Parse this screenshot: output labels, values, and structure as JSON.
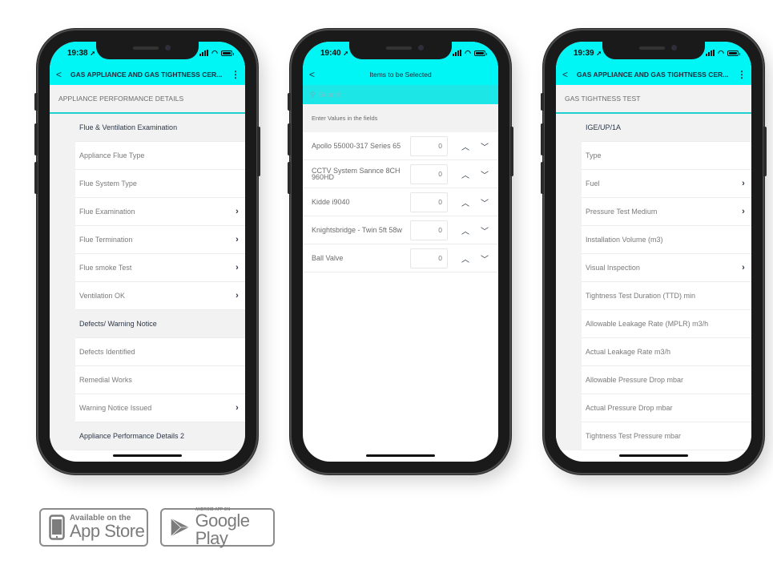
{
  "phones": [
    {
      "time": "19:38",
      "app_bar": {
        "back": "<",
        "title": "GAS APPLIANCE AND GAS TIGHTNESS CER...",
        "menu": "⋮"
      },
      "section_title": "APPLIANCE PERFORMANCE DETAILS",
      "rows": [
        {
          "label": "Flue & Ventilation Examination",
          "group": true,
          "chevron": false
        },
        {
          "label": "Appliance Flue Type",
          "group": false,
          "chevron": false
        },
        {
          "label": "Flue System Type",
          "group": false,
          "chevron": false
        },
        {
          "label": "Flue Examination",
          "group": false,
          "chevron": true
        },
        {
          "label": "Flue Termination",
          "group": false,
          "chevron": true
        },
        {
          "label": "Flue smoke Test",
          "group": false,
          "chevron": true
        },
        {
          "label": "Ventilation OK",
          "group": false,
          "chevron": true
        },
        {
          "label": "Defects/ Warning Notice",
          "group": true,
          "chevron": false
        },
        {
          "label": "Defects Identified",
          "group": false,
          "chevron": false
        },
        {
          "label": "Remedial Works",
          "group": false,
          "chevron": false
        },
        {
          "label": "Warning Notice Issued",
          "group": false,
          "chevron": true
        },
        {
          "label": "Appliance Performance Details 2",
          "group": true,
          "chevron": false
        }
      ]
    },
    {
      "time": "19:40",
      "app_bar": {
        "back": "<",
        "title": "Items to be Selected"
      },
      "search_placeholder": "Search",
      "hint": "Enter Values in the fields",
      "items": [
        {
          "name": "Apollo 55000-317 Series 65",
          "qty": "0"
        },
        {
          "name": "CCTV System Sannce 8CH 960HD",
          "qty": "0"
        },
        {
          "name": "Kidde i9040",
          "qty": "0"
        },
        {
          "name": "Knightsbridge - Twin 5ft 58w",
          "qty": "0"
        },
        {
          "name": "Ball Valve",
          "qty": "0"
        }
      ]
    },
    {
      "time": "19:39",
      "app_bar": {
        "back": "<",
        "title": "GAS APPLIANCE AND GAS TIGHTNESS CER...",
        "menu": "⋮"
      },
      "section_title": "GAS TIGHTNESS TEST",
      "rows": [
        {
          "label": "IGE/UP/1A",
          "group": true,
          "chevron": false
        },
        {
          "label": "Type",
          "group": false,
          "chevron": false
        },
        {
          "label": "Fuel",
          "group": false,
          "chevron": true
        },
        {
          "label": "Pressure Test Medium",
          "group": false,
          "chevron": true
        },
        {
          "label": "Installation Volume (m3)",
          "group": false,
          "chevron": false
        },
        {
          "label": "Visual Inspection",
          "group": false,
          "chevron": true
        },
        {
          "label": "Tightness Test Duration (TTD) min",
          "group": false,
          "chevron": false
        },
        {
          "label": "Allowable Leakage Rate (MPLR) m3/h",
          "group": false,
          "chevron": false
        },
        {
          "label": "Actual Leakage Rate m3/h",
          "group": false,
          "chevron": false
        },
        {
          "label": "Allowable Pressure Drop mbar",
          "group": false,
          "chevron": false
        },
        {
          "label": "Actual Pressure Drop mbar",
          "group": false,
          "chevron": false
        },
        {
          "label": "Tightness Test Pressure mbar",
          "group": false,
          "chevron": false
        }
      ]
    }
  ],
  "badges": {
    "app_store": {
      "small": "Available on the",
      "big": "App Store"
    },
    "google_play": {
      "small": "ANDROID APP ON",
      "big": "Google Play"
    }
  },
  "icons": {
    "chevron": "›",
    "up": "︿",
    "down": "﹀",
    "location": "➚",
    "search": "⚲"
  },
  "colors": {
    "accent": "#00f5f5",
    "divider": "#1fd0d0"
  }
}
